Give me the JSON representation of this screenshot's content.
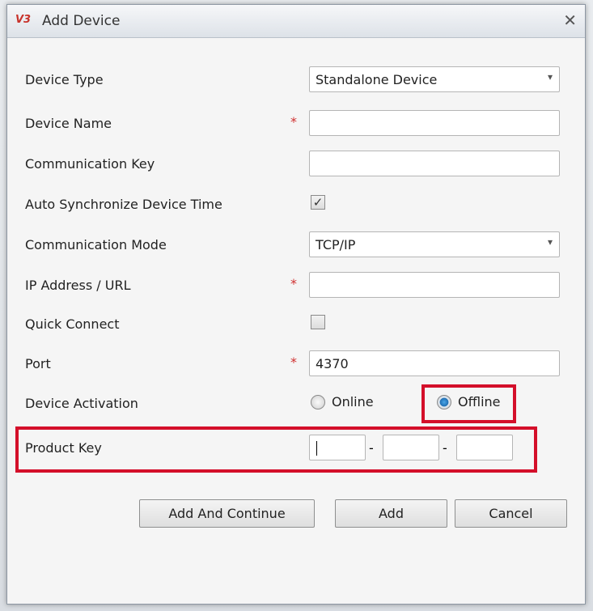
{
  "dialog": {
    "title": "Add Device",
    "logo_text": "V3",
    "close_icon": "close-icon"
  },
  "form": {
    "device_type": {
      "label": "Device Type",
      "value": "Standalone Device"
    },
    "device_name": {
      "label": "Device Name",
      "value": "",
      "required": "*"
    },
    "communication_key": {
      "label": "Communication Key",
      "value": ""
    },
    "auto_sync": {
      "label": "Auto Synchronize Device Time",
      "checked": true,
      "mark": "✓"
    },
    "communication_mode": {
      "label": "Communication Mode",
      "value": "TCP/IP"
    },
    "ip_address": {
      "label": "IP Address / URL",
      "value": "",
      "required": "*"
    },
    "quick_connect": {
      "label": "Quick Connect",
      "checked": false
    },
    "port": {
      "label": "Port",
      "value": "4370",
      "required": "*"
    },
    "device_activation": {
      "label": "Device Activation",
      "options": [
        "Online",
        "Offline"
      ],
      "selected": "Offline"
    },
    "product_key": {
      "label": "Product Key",
      "separator": "-",
      "parts": [
        "",
        "",
        ""
      ]
    }
  },
  "buttons": {
    "add_continue": "Add And Continue",
    "add": "Add",
    "cancel": "Cancel"
  },
  "highlight_color": "#d40f2a"
}
